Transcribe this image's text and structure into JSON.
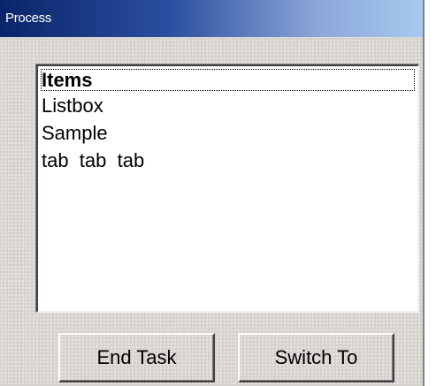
{
  "window": {
    "title": "Process"
  },
  "listbox": {
    "items": [
      {
        "label": "Items",
        "focused": true
      },
      {
        "label": "Listbox",
        "focused": false
      },
      {
        "label": "Sample",
        "focused": false
      },
      {
        "label": "tab  tab  tab",
        "focused": false
      }
    ]
  },
  "buttons": {
    "end_task": "End Task",
    "switch_to": "Switch To"
  },
  "colors": {
    "title_gradient_start": "#0a246a",
    "title_gradient_end": "#a6caf0",
    "dialog_face": "#d6d3ce",
    "list_background": "#ffffff"
  }
}
